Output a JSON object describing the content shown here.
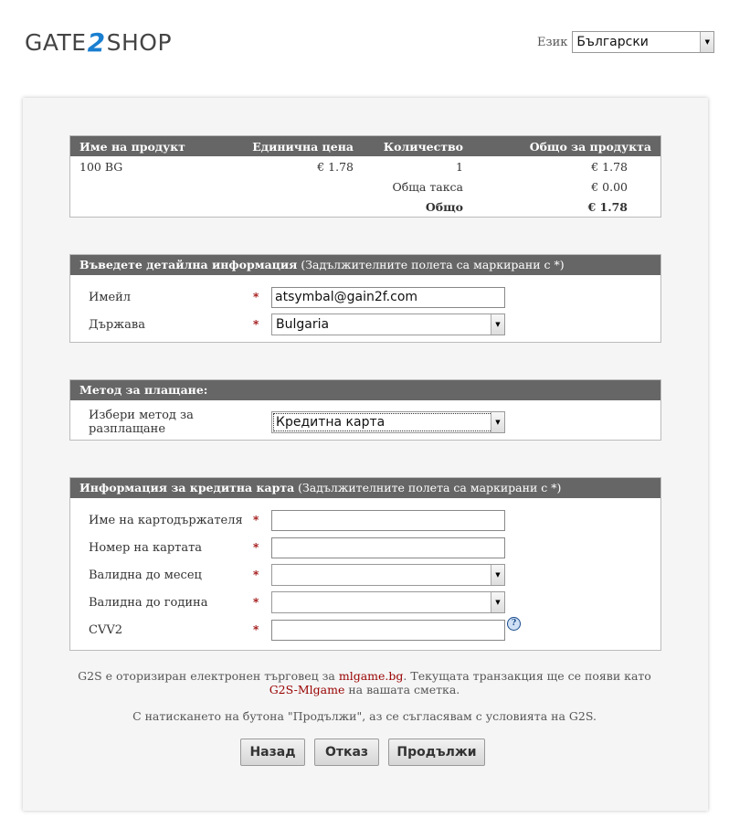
{
  "header": {
    "logo_left": "GATE",
    "logo_mid": "2",
    "logo_right": "SHOP",
    "language_label": "Език",
    "language_value": "Български"
  },
  "products": {
    "columns": [
      "Име на продукт",
      "Единична цена",
      "Количество",
      "Общо за продукта"
    ],
    "rows": [
      {
        "name": "100 BG",
        "unit_price": "€ 1.78",
        "quantity": "1",
        "total": "€ 1.78"
      }
    ],
    "fee_label": "Обща такса",
    "fee_value": "€ 0.00",
    "total_label": "Общо",
    "total_value": "€ 1.78"
  },
  "details": {
    "title_bold": "Въведете детайлна информация",
    "title_note": " (Задължителните полета са маркирани с *)",
    "email_label": "Имейл",
    "email_value": "atsymbal@gain2f.com",
    "country_label": "Държава",
    "country_value": "Bulgaria",
    "required_mark": "*"
  },
  "payment": {
    "title": "Метод за плащане:",
    "method_label": "Избери метод за разплащане",
    "method_value": "Кредитна карта"
  },
  "card": {
    "title_bold": "Информация за кредитна карта",
    "title_note": " (Задължителните полета са маркирани с *)",
    "holder_label": "Име на картодържателя",
    "number_label": "Номер на картата",
    "month_label": "Валидна до месец",
    "year_label": "Валидна до година",
    "cvv_label": "CVV2",
    "help_glyph": "?"
  },
  "footer": {
    "line1_a": "G2S е оторизиран електронен търговец за ",
    "line1_link": "mlgame.bg",
    "line1_b": ". Текущата транзакция ще се появи като",
    "line2_link": "G2S-Mlgame",
    "line2_b": " на вашата сметка.",
    "agree": "С натискането на бутона \"Продължи\", аз се съгласявам с условията на G2S."
  },
  "buttons": {
    "back": "Назад",
    "cancel": "Отказ",
    "continue": "Продължи"
  },
  "colors": {
    "header_bar": "#666666",
    "accent_red": "#990000",
    "logo_blue": "#1a7fd0"
  }
}
